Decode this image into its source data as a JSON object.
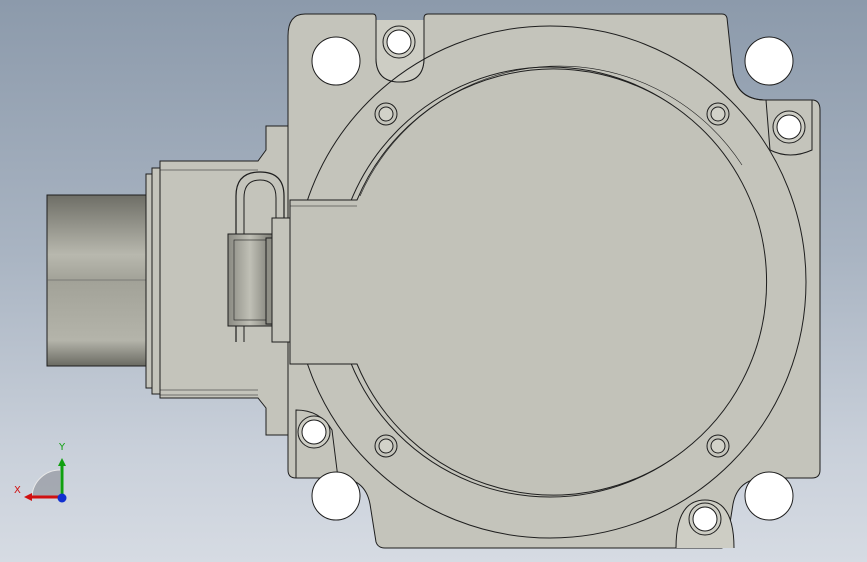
{
  "viewport": {
    "name": "3d-model-viewport",
    "background_top": "#8c9aab",
    "background_bottom": "#d6dbe3"
  },
  "model": {
    "body_color": "#c4c4bb",
    "highlight_color": "#cdcdc4",
    "edge_color": "#1e1e1e",
    "shaft_color": "#8f8f86"
  },
  "triad": {
    "x_label": "X",
    "y_label": "Y",
    "x_color": "#d01010",
    "y_color": "#10a010",
    "z_color": "#1030d0"
  }
}
